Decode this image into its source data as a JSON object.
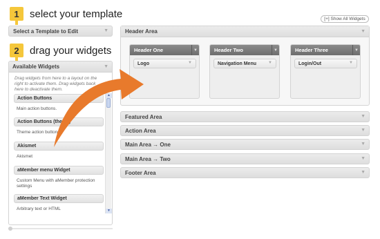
{
  "steps": [
    {
      "number": "1",
      "text": "select your template"
    },
    {
      "number": "2",
      "text": "drag your widgets"
    }
  ],
  "template_select": {
    "label": "Select a Template to Edit",
    "icon": "chevron-down-icon"
  },
  "show_all": {
    "label": "[+] Show All Widgets"
  },
  "available_widgets": {
    "title": "Available Widgets",
    "description": "Drag widgets from here to a layout on the right to activate them. Drag widgets back here to deactivate them.",
    "items": [
      {
        "title": "Action Buttons",
        "desc": "Main action buttons."
      },
      {
        "title": "Action Buttons (theme)",
        "desc": "Theme action buttons."
      },
      {
        "title": "Akismet",
        "desc": "Akismet"
      },
      {
        "title": "aMember menu Widget",
        "desc": "Custom Menu with aMember protection settings"
      },
      {
        "title": "aMember Text Widget",
        "desc": "Arbitrary text or HTML"
      }
    ]
  },
  "header_area": {
    "title": "Header Area",
    "columns": [
      {
        "title": "Header One",
        "widget": "Logo"
      },
      {
        "title": "Header Two",
        "widget": "Navigation Menu"
      },
      {
        "title": "Header Three",
        "widget": "Login/Out"
      }
    ]
  },
  "areas": [
    {
      "label": "Featured Area"
    },
    {
      "label": "Action Area"
    },
    {
      "label": "Main Area → One"
    },
    {
      "label": "Main Area → Two"
    },
    {
      "label": "Footer Area"
    }
  ],
  "colors": {
    "accent_arrow": "#e87a2c",
    "step_badge": "#f5c73b"
  }
}
